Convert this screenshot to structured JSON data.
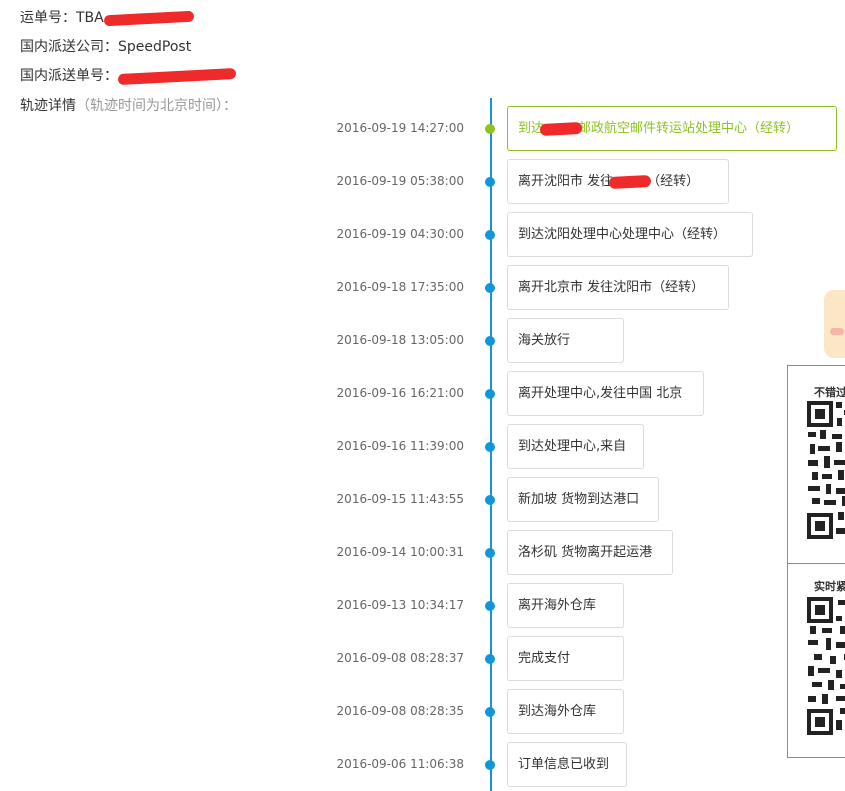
{
  "shipment": {
    "tracking_label": "运单号：",
    "tracking_visible": "TBA",
    "carrier_label": "国内派送公司：",
    "carrier_value": "SpeedPost",
    "domestic_no_label": "国内派送单号：",
    "detail_label": "轨迹详情",
    "detail_hint": "（轨迹时间为北京时间）："
  },
  "events": [
    {
      "time": "2016-09-19 14:27:00",
      "text_before": "到达",
      "redacted": true,
      "text_after": "邮政航空邮件转运站处理中心（经转）",
      "latest": true
    },
    {
      "time": "2016-09-19 05:38:00",
      "text_before": "离开沈阳市 发往",
      "redacted": true,
      "text_after": "（经转）"
    },
    {
      "time": "2016-09-19 04:30:00",
      "text_before": "到达沈阳处理中心处理中心（经转）"
    },
    {
      "time": "2016-09-18 17:35:00",
      "text_before": "离开北京市 发往沈阳市（经转）"
    },
    {
      "time": "2016-09-18 13:05:00",
      "text_before": "海关放行"
    },
    {
      "time": "2016-09-16 16:21:00",
      "text_before": "离开处理中心,发往中国 北京"
    },
    {
      "time": "2016-09-16 11:39:00",
      "text_before": "到达处理中心,来自"
    },
    {
      "time": "2016-09-15 11:43:55",
      "text_before": "新加坡 货物到达港口"
    },
    {
      "time": "2016-09-14 10:00:31",
      "text_before": "洛杉矶 货物离开起运港"
    },
    {
      "time": "2016-09-13 10:34:17",
      "text_before": "离开海外仓库"
    },
    {
      "time": "2016-09-08 08:28:37",
      "text_before": "完成支付"
    },
    {
      "time": "2016-09-08 08:28:35",
      "text_before": "到达海外仓库"
    },
    {
      "time": "2016-09-06 11:06:38",
      "text_before": "订单信息已收到"
    }
  ],
  "side_panel": {
    "qr1_title": "不错过",
    "qr2_title": "实时紧"
  },
  "colors": {
    "timeline": "#1296db",
    "latest": "#8ec31f",
    "redaction": "#ee2a2a"
  }
}
